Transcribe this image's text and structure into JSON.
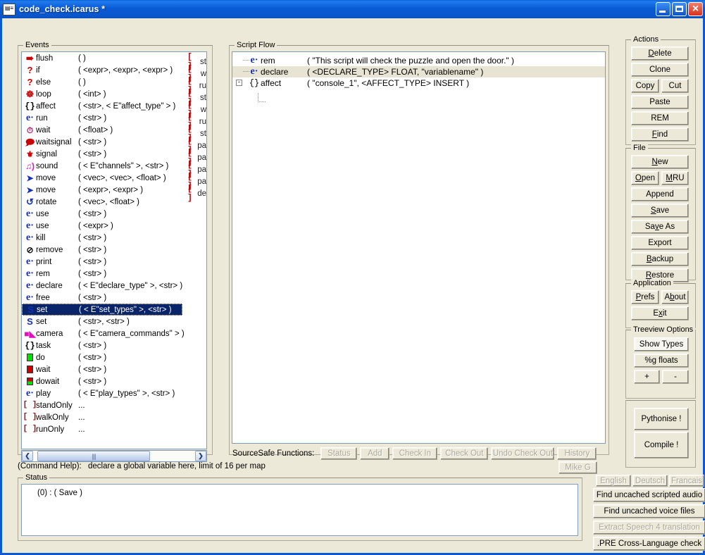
{
  "window": {
    "title": "code_check.icarus *",
    "icon": "app-icon",
    "controls": {
      "minimize": "minimize",
      "maximize": "maximize",
      "close": "close"
    }
  },
  "events_panel": {
    "legend": "Events",
    "selected_index": 21,
    "rows": [
      {
        "icon": "flush-icon",
        "name": "flush",
        "args": "(  )",
        "right": "st"
      },
      {
        "icon": "question-icon",
        "name": "if",
        "args": "( <expr>, <expr>, <expr>  )",
        "right": "w"
      },
      {
        "icon": "question-icon",
        "name": "else",
        "args": "(  )",
        "right": "ru"
      },
      {
        "icon": "loop-icon",
        "name": "loop",
        "args": "( <int>  )",
        "right": "st"
      },
      {
        "icon": "braces-icon",
        "name": "affect",
        "args": "( <str>, < E\"affect_type\" >  )",
        "right": "w"
      },
      {
        "icon": "e-icon",
        "name": "run",
        "args": "( <str>  )",
        "right": "ru"
      },
      {
        "icon": "clock-icon",
        "name": "wait",
        "args": "( <float>  )",
        "right": "st"
      },
      {
        "icon": "waitsignal-icon",
        "name": "waitsignal",
        "args": "( <str>  )",
        "right": "pa"
      },
      {
        "icon": "signal-icon",
        "name": "signal",
        "args": "( <str>  )",
        "right": "pa"
      },
      {
        "icon": "sound-icon",
        "name": "sound",
        "args": "( < E\"channels\" >, <str>  )",
        "right": "pa"
      },
      {
        "icon": "move-icon",
        "name": "move",
        "args": "( <vec>, <vec>, <float>  )",
        "right": "pa"
      },
      {
        "icon": "move-icon",
        "name": "move",
        "args": "( <expr>, <expr>  )",
        "right": "de"
      },
      {
        "icon": "rotate-icon",
        "name": "rotate",
        "args": "( <vec>, <float>  )",
        "right": ""
      },
      {
        "icon": "e-icon",
        "name": "use",
        "args": "( <str>  )",
        "right": ""
      },
      {
        "icon": "e-icon",
        "name": "use",
        "args": "( <expr>  )",
        "right": ""
      },
      {
        "icon": "e-icon",
        "name": "kill",
        "args": "( <str>  )",
        "right": ""
      },
      {
        "icon": "remove-icon",
        "name": "remove",
        "args": "( <str>  )",
        "right": ""
      },
      {
        "icon": "e-icon",
        "name": "print",
        "args": "( <str>  )",
        "right": ""
      },
      {
        "icon": "e-icon",
        "name": "rem",
        "args": "( <str>  )",
        "right": ""
      },
      {
        "icon": "e-icon",
        "name": "declare",
        "args": "( < E\"declare_type\" >, <str>  )",
        "right": ""
      },
      {
        "icon": "e-icon",
        "name": "free",
        "args": "( <str>  )",
        "right": ""
      },
      {
        "icon": "set-icon",
        "name": "set",
        "args": "( < E\"set_types\" >, <str>  )",
        "right": ""
      },
      {
        "icon": "set-icon",
        "name": "set",
        "args": "( <str>, <str>  )",
        "right": ""
      },
      {
        "icon": "camera-icon",
        "name": "camera",
        "args": "( < E\"camera_commands\" >  )",
        "right": ""
      },
      {
        "icon": "braces-icon",
        "name": "task",
        "args": "( <str>  )",
        "right": ""
      },
      {
        "icon": "green-square-icon",
        "name": "do",
        "args": "( <str>  )",
        "right": ""
      },
      {
        "icon": "red-square-icon",
        "name": "wait",
        "args": "( <str>  )",
        "right": ""
      },
      {
        "icon": "redgreen-square-icon",
        "name": "dowait",
        "args": "( <str>  )",
        "right": ""
      },
      {
        "icon": "e-icon",
        "name": "play",
        "args": "( < E\"play_types\" >, <str>  )",
        "right": ""
      },
      {
        "icon": "brackets-icon",
        "name": "standOnly",
        "args": "...",
        "right": ""
      },
      {
        "icon": "brackets-icon",
        "name": "walkOnly",
        "args": "...",
        "right": ""
      },
      {
        "icon": "brackets-icon",
        "name": "runOnly",
        "args": "...",
        "right": ""
      }
    ],
    "scrollbar": {
      "left_arrow": "❮",
      "right_arrow": "❯",
      "thumb": "||||"
    }
  },
  "script_flow": {
    "legend": "Script Flow",
    "rows": [
      {
        "icon": "e-icon",
        "name": "rem",
        "args": "( \"This script will check the puzzle and open the door.\"  )",
        "expander": "",
        "highlight": false
      },
      {
        "icon": "e-icon",
        "name": "declare",
        "args": "( <DECLARE_TYPE> FLOAT, \"variablename\"  )",
        "expander": "",
        "highlight": true
      },
      {
        "icon": "braces-icon",
        "name": "affect",
        "args": "( \"console_1\", <AFFECT_TYPE> INSERT  )",
        "expander": "-",
        "highlight": false
      }
    ],
    "sourcesafe": {
      "label": "SourceSafe Functions:",
      "buttons": [
        {
          "label": "Status",
          "disabled": true
        },
        {
          "label": "Add",
          "disabled": true
        },
        {
          "label": "Check In",
          "disabled": true
        },
        {
          "label": "Check Out",
          "disabled": true
        },
        {
          "label": "Undo Check Out",
          "disabled": true
        },
        {
          "label": "History",
          "disabled": true
        }
      ]
    }
  },
  "actions_panel": {
    "legend": "Actions",
    "buttons": [
      {
        "label": "Delete",
        "accel": "D"
      },
      {
        "label": "Clone",
        "accel": ""
      },
      {
        "label": "Copy",
        "accel": ""
      },
      {
        "label": "Cut",
        "accel": ""
      },
      {
        "label": "Paste",
        "accel": ""
      },
      {
        "label": "REM",
        "accel": ""
      },
      {
        "label": "Find",
        "accel": "F"
      }
    ]
  },
  "file_panel": {
    "legend": "File",
    "buttons": [
      {
        "label": "New",
        "accel": "N"
      },
      {
        "label": "Open",
        "accel": "O"
      },
      {
        "label": "MRU",
        "accel": "M"
      },
      {
        "label": "Append",
        "accel": ""
      },
      {
        "label": "Save",
        "accel": "S"
      },
      {
        "label": "Save As",
        "accel": "v"
      },
      {
        "label": "Export",
        "accel": ""
      },
      {
        "label": "Backup",
        "accel": "B"
      },
      {
        "label": "Restore",
        "accel": "R"
      }
    ]
  },
  "application_panel": {
    "legend": "Application",
    "buttons": [
      {
        "label": "Prefs",
        "accel": "P"
      },
      {
        "label": "About",
        "accel": "b"
      },
      {
        "label": "Exit",
        "accel": "x"
      }
    ]
  },
  "treeview_panel": {
    "legend": "Treeview Options",
    "buttons": [
      {
        "label": "Show Types",
        "active": true
      },
      {
        "label": "%g floats",
        "active": false
      },
      {
        "label": "+",
        "active": false
      },
      {
        "label": "-",
        "active": false
      }
    ]
  },
  "compile_panel": {
    "buttons": [
      {
        "label": "Pythonise !"
      },
      {
        "label": "Compile !"
      }
    ]
  },
  "command_help": {
    "label": "(Command Help):",
    "text": "declare a global variable here, limit of 16 per map"
  },
  "status_panel": {
    "legend": "Status",
    "text": "(0) : ( Save )"
  },
  "user_button": {
    "label": "Mike G",
    "disabled": true
  },
  "language_tools": {
    "languages": [
      {
        "label": "English",
        "disabled": true
      },
      {
        "label": "Deutsch",
        "disabled": true
      },
      {
        "label": "Francais",
        "disabled": true
      }
    ],
    "tools": [
      {
        "label": "Find uncached scripted audio",
        "disabled": false
      },
      {
        "label": "Find uncached voice files",
        "disabled": false
      },
      {
        "label": "Extract Speech 4 translation",
        "disabled": true
      },
      {
        "label": ".PRE Cross-Language check",
        "disabled": false
      }
    ]
  },
  "colors": {
    "titlebar_blue": "#0a5ad6",
    "face": "#ece9d8",
    "selection": "#0a246a",
    "icon_red": "#cc0000",
    "icon_blue": "#1430b8",
    "icon_magenta": "#e010c0",
    "bracket_red": "#b40000"
  }
}
